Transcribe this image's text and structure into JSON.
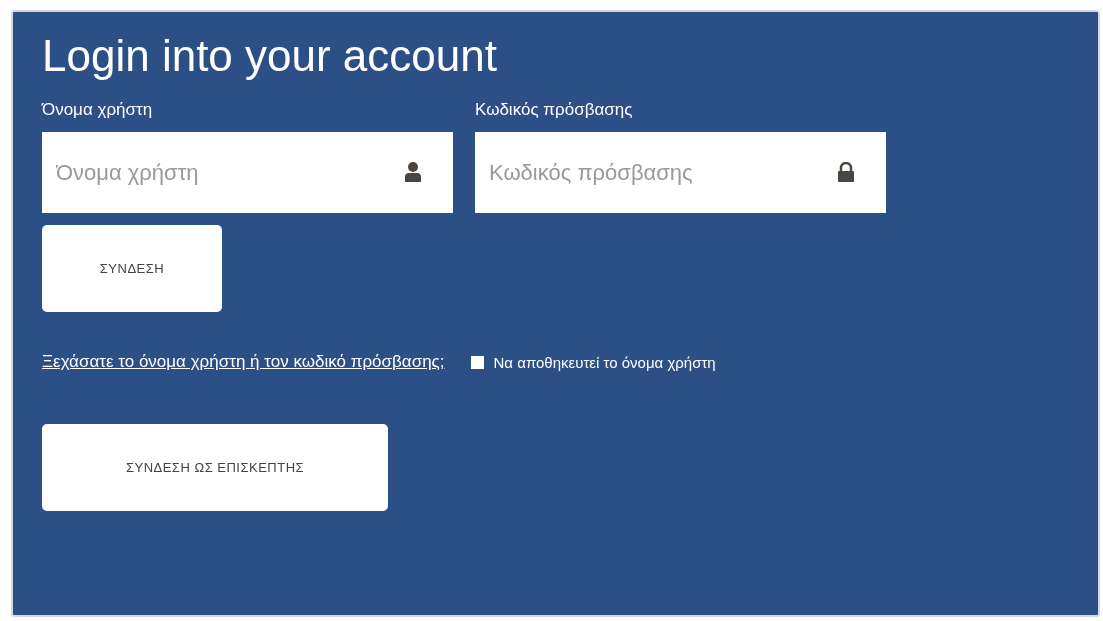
{
  "title": "Login into your account",
  "fields": [
    {
      "label": "Όνομα χρήστη",
      "placeholder": "Όνομα χρήστη",
      "kind": "user"
    },
    {
      "label": "Κωδικός πρόσβασης",
      "placeholder": "Κωδικός πρόσβασης",
      "kind": "password"
    }
  ],
  "login_button": "ΣΥΝΔΕΣΗ",
  "forgot_link": "Ξεχάσατε το όνομα χρήστη ή τον κωδικό πρόσβασης;",
  "remember": {
    "label": "Να αποθηκευτεί το όνομα χρήστη",
    "checked": false
  },
  "guest_button": "ΣΥΝΔΕΣΗ ΩΣ ΕΠΙΣΚΕΠΤΗΣ"
}
